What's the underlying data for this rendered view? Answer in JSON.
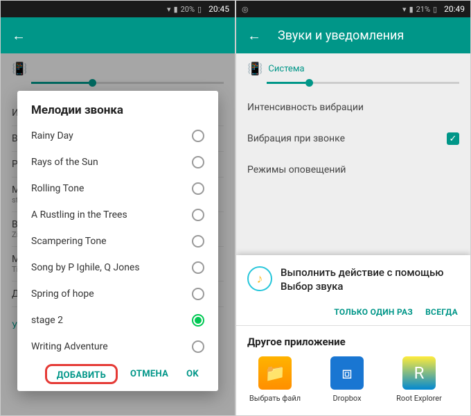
{
  "phone1": {
    "status": {
      "battery": "20%",
      "time": "20:45"
    },
    "dialog": {
      "title": "Мелодии звонка",
      "items": [
        {
          "label": "Rainy Day",
          "selected": false
        },
        {
          "label": "Rays of the Sun",
          "selected": false
        },
        {
          "label": "Rolling Tone",
          "selected": false
        },
        {
          "label": "A Rustling in the Trees",
          "selected": false
        },
        {
          "label": "Scampering Tone",
          "selected": false
        },
        {
          "label": "Song by P Ighile, Q Jones",
          "selected": false
        },
        {
          "label": "Spring of hope",
          "selected": false
        },
        {
          "label": "stage 2",
          "selected": true
        },
        {
          "label": "Writing Adventure",
          "selected": false
        }
      ],
      "add": "ДОБАВИТЬ",
      "cancel": "ОТМЕНА",
      "ok": "OK"
    },
    "bg": {
      "notify": "Уведомление"
    }
  },
  "phone2": {
    "status": {
      "battery": "21%",
      "time": "20:49"
    },
    "toolbar": {
      "title": "Звуки и уведомления"
    },
    "slider_label": "Система",
    "rows": {
      "intensity": "Интенсивность вибрации",
      "vibrate_call": "Вибрация при звонке",
      "alert_modes": "Режимы оповещений"
    },
    "action": {
      "title": "Выполнить действие с помощью Выбор звука",
      "once": "ТОЛЬКО ОДИН РАЗ",
      "always": "ВСЕГДА",
      "other_title": "Другое приложение",
      "apps": [
        {
          "label": "Выбрать файл",
          "icon": "file"
        },
        {
          "label": "Dropbox",
          "icon": "dropbox"
        },
        {
          "label": "Root Explorer",
          "icon": "root"
        }
      ]
    }
  }
}
